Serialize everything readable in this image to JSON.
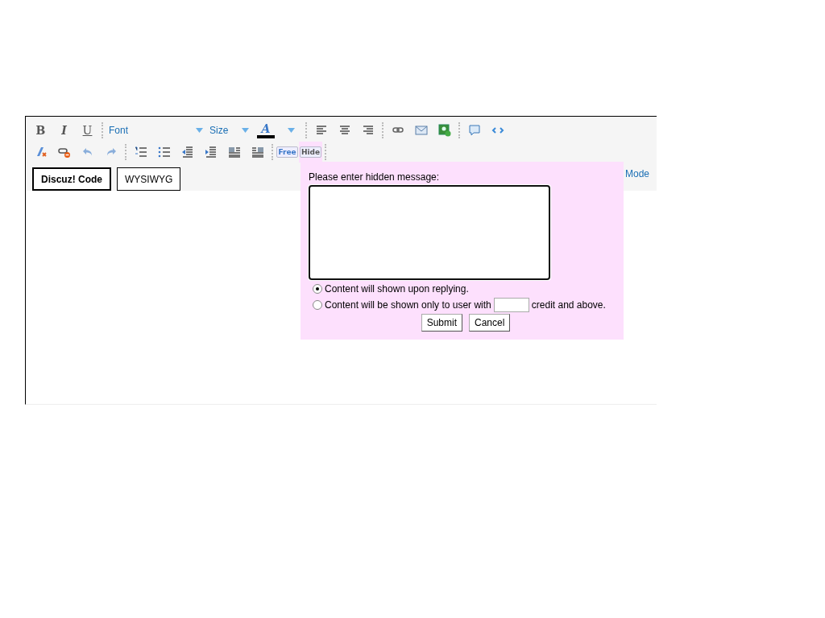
{
  "toolbar": {
    "row_1": [
      {
        "kind": "bold",
        "label": "B"
      },
      {
        "kind": "italic",
        "label": "I"
      },
      {
        "kind": "underline",
        "label": "U"
      },
      {
        "kind": "separator"
      },
      {
        "kind": "font",
        "label": "Font"
      },
      {
        "kind": "size",
        "label": "Size"
      },
      {
        "kind": "color",
        "label": "A",
        "color": "#000000"
      },
      {
        "kind": "separator"
      },
      {
        "kind": "align-left"
      },
      {
        "kind": "align-center"
      },
      {
        "kind": "align-right"
      },
      {
        "kind": "separator"
      },
      {
        "kind": "link"
      },
      {
        "kind": "email"
      },
      {
        "kind": "image"
      },
      {
        "kind": "separator"
      },
      {
        "kind": "quote"
      },
      {
        "kind": "code"
      }
    ],
    "row_2": [
      {
        "kind": "clear-format"
      },
      {
        "kind": "unlink"
      },
      {
        "kind": "undo"
      },
      {
        "kind": "redo"
      },
      {
        "kind": "separator"
      },
      {
        "kind": "ordered-list"
      },
      {
        "kind": "bullet-list"
      },
      {
        "kind": "outdent"
      },
      {
        "kind": "indent"
      },
      {
        "kind": "float-left"
      },
      {
        "kind": "float-right"
      },
      {
        "kind": "separator"
      },
      {
        "kind": "tag",
        "label": "Free",
        "selected": false
      },
      {
        "kind": "tag",
        "label": "Hide",
        "selected": true
      },
      {
        "kind": "separator"
      }
    ]
  },
  "mode_tabs": [
    {
      "label": "Discuz! Code",
      "selected": true
    },
    {
      "label": "WYSIWYG",
      "selected": false
    }
  ],
  "mode_link": "Mode",
  "hide_dialog": {
    "prompt": "Please enter hidden message:",
    "options": [
      {
        "label": "Content will shown upon replying.",
        "selected": true
      },
      {
        "label": "Content will be shown only to user with",
        "suffix": "credit and above.",
        "selected": false
      }
    ],
    "buttons": [
      "Submit",
      "Cancel"
    ]
  }
}
